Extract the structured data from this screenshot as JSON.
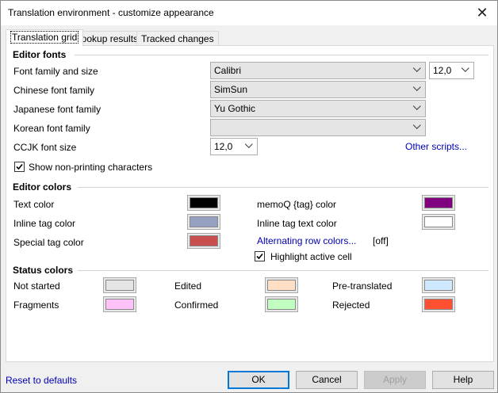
{
  "window": {
    "title": "Translation environment - customize appearance"
  },
  "tabs": [
    {
      "label": "Translation grid",
      "active": true
    },
    {
      "label": "Lookup results",
      "active": false
    },
    {
      "label": "Tracked changes",
      "active": false
    }
  ],
  "editor_fonts": {
    "heading": "Editor fonts",
    "font_family_label": "Font family and size",
    "font_family_value": "Calibri",
    "font_size_value": "12,0",
    "chinese_label": "Chinese font family",
    "chinese_value": "SimSun",
    "japanese_label": "Japanese font family",
    "japanese_value": "Yu Gothic",
    "korean_label": "Korean font family",
    "korean_value": "",
    "ccjk_size_label": "CCJK font size",
    "ccjk_size_value": "12,0",
    "other_scripts_link": "Other scripts...",
    "show_nonprinting_label": "Show non-printing characters",
    "show_nonprinting_checked": true
  },
  "editor_colors": {
    "heading": "Editor colors",
    "text_color_label": "Text color",
    "text_color": "#000000",
    "inline_tag_label": "Inline tag color",
    "inline_tag_color": "#95a0c3",
    "special_tag_label": "Special tag color",
    "special_tag_color": "#c84f4f",
    "memoq_tag_label": "memoQ {tag} color",
    "memoq_tag_color": "#800080",
    "inline_tag_text_label": "Inline tag text color",
    "inline_tag_text_color": "#ffffff",
    "alternating_link": "Alternating row colors...",
    "alternating_state": "[off]",
    "highlight_label": "Highlight active cell",
    "highlight_checked": true
  },
  "status_colors": {
    "heading": "Status colors",
    "items": [
      {
        "label": "Not started",
        "color": "#e6e6e6"
      },
      {
        "label": "Edited",
        "color": "#ffe0c6"
      },
      {
        "label": "Pre-translated",
        "color": "#cde8ff"
      },
      {
        "label": "Fragments",
        "color": "#ffc2f8"
      },
      {
        "label": "Confirmed",
        "color": "#c0ffc0"
      },
      {
        "label": "Rejected",
        "color": "#ff5032"
      }
    ]
  },
  "footer": {
    "reset_link": "Reset to defaults",
    "ok": "OK",
    "cancel": "Cancel",
    "apply": "Apply",
    "help": "Help"
  }
}
